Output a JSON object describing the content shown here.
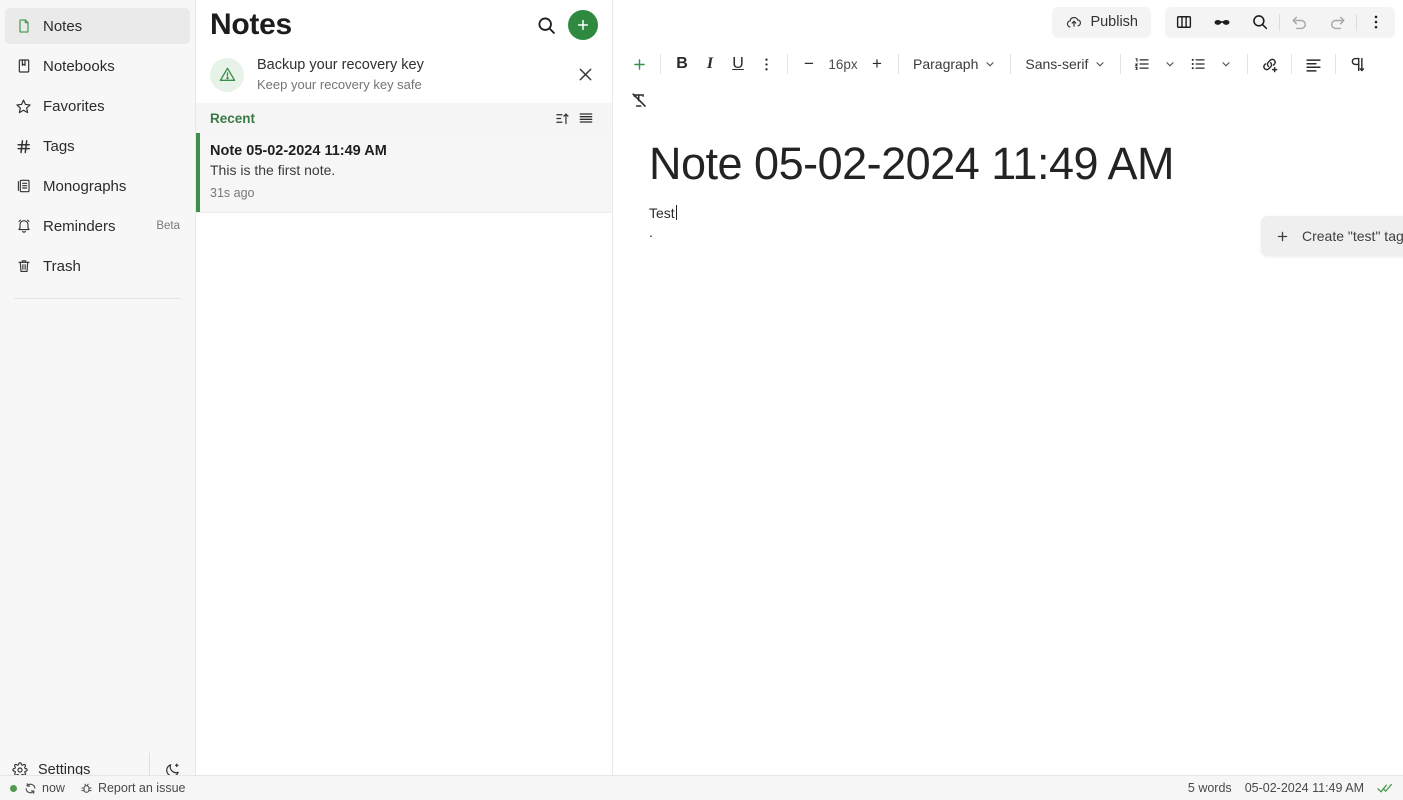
{
  "colors": {
    "accent_green": "#2f8a3f",
    "selected_border": "#3e8e4c",
    "section_label": "#3c7a45",
    "sidebar_bg": "#f7f7f7",
    "note_selected_bg": "#f6f6f6",
    "status_online": "#4f9a4f"
  },
  "sidebar": {
    "items": [
      {
        "label": "Notes",
        "icon": "note-icon",
        "badge": "",
        "active": true
      },
      {
        "label": "Notebooks",
        "icon": "notebook-icon",
        "badge": "",
        "active": false
      },
      {
        "label": "Favorites",
        "icon": "star-icon",
        "badge": "",
        "active": false
      },
      {
        "label": "Tags",
        "icon": "hash-icon",
        "badge": "",
        "active": false
      },
      {
        "label": "Monographs",
        "icon": "monograph-icon",
        "badge": "",
        "active": false
      },
      {
        "label": "Reminders",
        "icon": "bell-icon",
        "badge": "Beta",
        "active": false
      },
      {
        "label": "Trash",
        "icon": "trash-icon",
        "badge": "",
        "active": false
      }
    ],
    "settings_label": "Settings",
    "settings_icon": "gear-icon",
    "theme_icon": "moon-icon"
  },
  "notelist": {
    "title": "Notes",
    "search_icon": "search-icon",
    "add_icon": "plus-icon",
    "banner": {
      "icon": "warning-triangle-icon",
      "title": "Backup your recovery key",
      "subtitle": "Keep your recovery key safe",
      "close_icon": "close-icon"
    },
    "section": {
      "label": "Recent",
      "sort_icon": "sort-ascending-icon",
      "view_icon": "list-view-icon"
    },
    "notes": [
      {
        "title": "Note 05-02-2024 11:49 AM",
        "preview": "This is the first note.",
        "time": "31s ago",
        "selected": true
      }
    ]
  },
  "editor": {
    "topbar": {
      "publish_label": "Publish",
      "publish_icon": "cloud-upload-icon",
      "sidebar_toggle_icon": "panel-layout-icon",
      "focus_icon": "glasses-icon",
      "search_icon": "search-icon",
      "undo_icon": "undo-icon",
      "redo_icon": "redo-icon",
      "more_icon": "kebab-menu-icon"
    },
    "toolbar": {
      "insert_icon": "plus-icon",
      "bold_label": "B",
      "italic_label": "I",
      "underline_label": "U",
      "more_icon": "kebab-menu-icon",
      "font_size_decrease": "−",
      "font_size_value": "16px",
      "font_size_increase": "+",
      "block_style": "Paragraph",
      "font_family": "Sans-serif",
      "numbered_list_icon": "numbered-list-icon",
      "bulleted_list_icon": "bulleted-list-icon",
      "link_icon": "add-link-icon",
      "align_icon": "align-left-icon",
      "direction_icon": "text-direction-icon",
      "clear_format_icon": "clear-formatting-icon",
      "chevron_icon": "chevron-down-icon"
    },
    "note": {
      "title": "Note 05-02-2024 11:49 AM",
      "body_line": "Test",
      "hidden_line": "."
    },
    "tag_dropdown": {
      "icon": "plus-icon",
      "label": "Create \"test\" tag"
    }
  },
  "statusbar": {
    "sync_icon": "sync-icon",
    "sync_label": "now",
    "issue_icon": "bug-icon",
    "issue_label": "Report an issue",
    "word_count": "5 words",
    "timestamp": "05-02-2024 11:49 AM",
    "saved_icon": "double-check-icon"
  }
}
